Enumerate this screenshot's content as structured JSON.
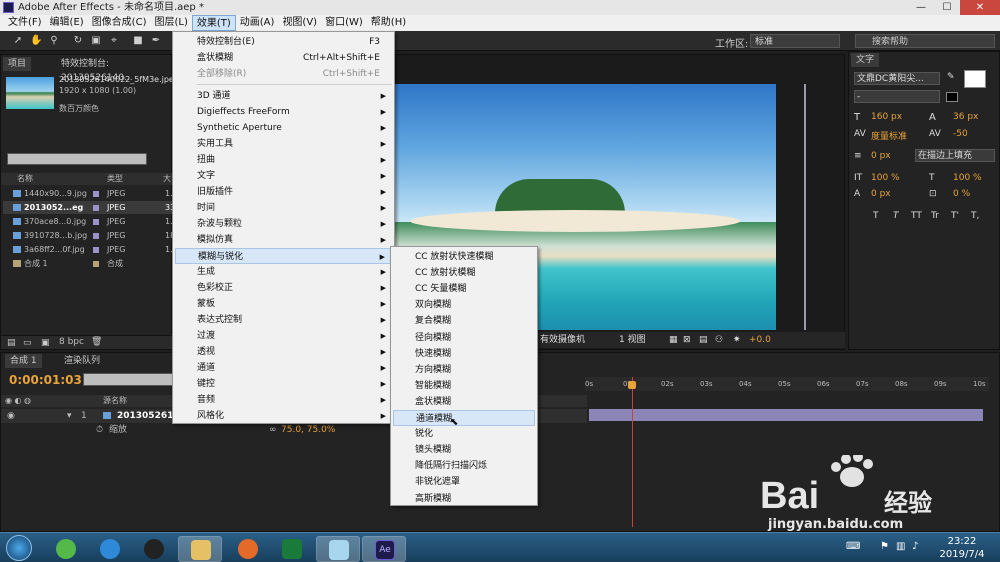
{
  "window": {
    "title": "Adobe After Effects - 未命名项目.aep *",
    "controls": [
      "—",
      "☐",
      "✕"
    ]
  },
  "menubar": {
    "items": [
      "文件(F)",
      "编辑(E)",
      "图像合成(C)",
      "图层(L)",
      "效果(T)",
      "动画(A)",
      "视图(V)",
      "窗口(W)",
      "帮助(H)"
    ],
    "active_index": 4
  },
  "toolbar": {
    "workspace_label": "工作区:",
    "workspace_value": "标准",
    "help_search_placeholder": "搜索帮助"
  },
  "project_panel": {
    "tabs": [
      "项目",
      "特效控制台: 20130526140..."
    ],
    "selected_name": "20130526140022_5fM3e.jpe",
    "selected_dims": "1920 x 1080 (1.00)",
    "selected_color": "数百万颜色",
    "col_name": "名称",
    "col_type": "类型",
    "col_size": "大",
    "files": [
      {
        "name": "1440x90...9.jpg",
        "type": "JPEG",
        "size": "1."
      },
      {
        "name": "2013052...eg",
        "type": "JPEG",
        "size": "33"
      },
      {
        "name": "370ace8...0.jpg",
        "type": "JPEG",
        "size": "1."
      },
      {
        "name": "3910728...b.jpg",
        "type": "JPEG",
        "size": "18"
      },
      {
        "name": "3a68ff2...0f.jpg",
        "type": "JPEG",
        "size": "1."
      },
      {
        "name": "合成 1",
        "type": "合成",
        "size": ""
      }
    ],
    "bpc": "8 bpc"
  },
  "viewer": {
    "camera": "有效摄像机",
    "views": "1 视图",
    "exposure": "+0.0"
  },
  "text_panel": {
    "title": "文字",
    "font_family": "文鼎DC黄阳尖...",
    "font_style": "-",
    "size": "160 px",
    "leading": "36 px",
    "kerning": "度量标准",
    "tracking": "-50",
    "stroke_width": "0 px",
    "stroke_mode": "在描边上填充",
    "vert_scale": "100 %",
    "horiz_scale": "100 %",
    "baseline": "0 px",
    "tsume": "0 %",
    "format_buttons": [
      "T",
      "T",
      "TT",
      "Tr",
      "T'",
      "T,"
    ]
  },
  "timeline": {
    "tabs": [
      "合成 1",
      "渲染队列"
    ],
    "timecode": "0:00:01:03",
    "col_name": "源名称",
    "layer_index": "1",
    "layer_name": "20130526140",
    "property": "缩放",
    "property_value": "75.0, 75.0%",
    "ruler": [
      "0s",
      "01s",
      "02s",
      "03s",
      "04s",
      "05s",
      "06s",
      "07s",
      "08s",
      "09s",
      "10s"
    ]
  },
  "effect_menu": {
    "items": [
      {
        "label": "特效控制台(E)",
        "accel": "F3"
      },
      {
        "label": "盒状模糊",
        "accel": "Ctrl+Alt+Shift+E"
      },
      {
        "label": "全部移除(R)",
        "accel": "Ctrl+Shift+E",
        "disabled": true
      },
      {
        "sep": true
      },
      {
        "label": "3D 通道",
        "sub": true
      },
      {
        "label": "Digieffects FreeForm",
        "sub": true
      },
      {
        "label": "Synthetic Aperture",
        "sub": true
      },
      {
        "label": "实用工具",
        "sub": true
      },
      {
        "label": "扭曲",
        "sub": true
      },
      {
        "label": "文字",
        "sub": true
      },
      {
        "label": "旧版插件",
        "sub": true
      },
      {
        "label": "时间",
        "sub": true
      },
      {
        "label": "杂波与颗粒",
        "sub": true
      },
      {
        "label": "模拟仿真",
        "sub": true
      },
      {
        "label": "模糊与锐化",
        "sub": true,
        "highlight": true
      },
      {
        "label": "生成",
        "sub": true
      },
      {
        "label": "色彩校正",
        "sub": true
      },
      {
        "label": "蒙板",
        "sub": true
      },
      {
        "label": "表达式控制",
        "sub": true
      },
      {
        "label": "过渡",
        "sub": true
      },
      {
        "label": "透视",
        "sub": true
      },
      {
        "label": "通道",
        "sub": true
      },
      {
        "label": "键控",
        "sub": true
      },
      {
        "label": "音频",
        "sub": true
      },
      {
        "label": "风格化",
        "sub": true
      }
    ]
  },
  "blur_submenu": {
    "items": [
      "CC 放射状快速模糊",
      "CC 放射状模糊",
      "CC 矢量模糊",
      "双向模糊",
      "复合模糊",
      "径向模糊",
      "快速模糊",
      "方向模糊",
      "智能模糊",
      "盒状模糊",
      "通道模糊",
      "锐化",
      "镜头模糊",
      "降低隔行扫描闪烁",
      "非锐化遮罩",
      "高斯模糊"
    ],
    "highlight_index": 10
  },
  "taskbar": {
    "time": "23:22",
    "date": "2019/7/4"
  },
  "watermark": {
    "brand": "Bai",
    "brand2": "经验",
    "url": "jingyan.baidu.com"
  },
  "colors": {
    "accent_timecode": "#e8a33a",
    "menu_highlight": "#d7e7f7",
    "taskbar": "#1f4d70",
    "close_btn": "#c9473e",
    "layer_bar": "#8c86b8"
  }
}
